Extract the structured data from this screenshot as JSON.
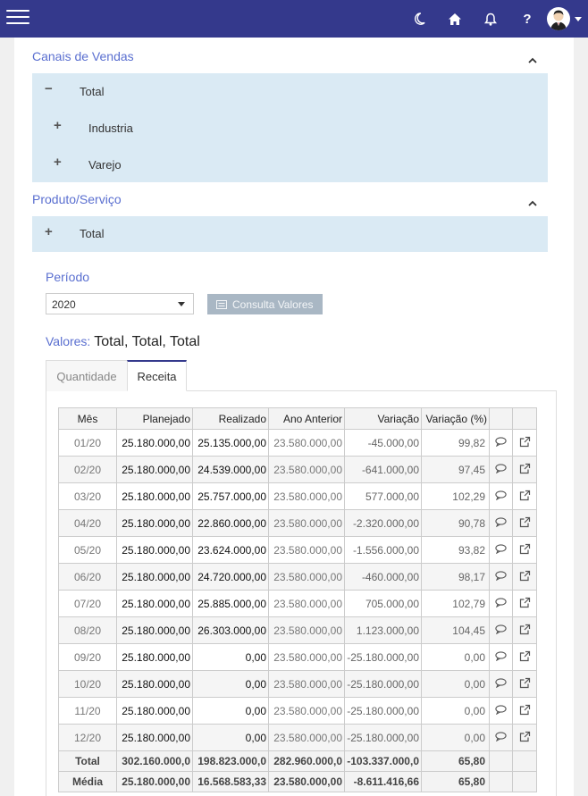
{
  "sections": {
    "canais": {
      "title": "Canais de Vendas",
      "rows": [
        {
          "toggle": "−",
          "label": "Total"
        },
        {
          "toggle": "+",
          "label": "Industria"
        },
        {
          "toggle": "+",
          "label": "Varejo"
        }
      ]
    },
    "produto": {
      "title": "Produto/Serviço",
      "rows": [
        {
          "toggle": "+",
          "label": "Total"
        }
      ]
    }
  },
  "filters": {
    "periodo_label": "Período",
    "periodo_value": "2020",
    "consulta_label": "Consulta Valores"
  },
  "valores": {
    "label": "Valores:",
    "values": "Total, Total, Total"
  },
  "tabs": [
    {
      "label": "Quantidade",
      "active": false
    },
    {
      "label": "Receita",
      "active": true
    }
  ],
  "table": {
    "headers": [
      "Mês",
      "Planejado",
      "Realizado",
      "Ano Anterior",
      "Variação",
      "Variação (%)"
    ],
    "rows": [
      [
        "01/20",
        "25.180.000,00",
        "25.135.000,00",
        "23.580.000,00",
        "-45.000,00",
        "99,82"
      ],
      [
        "02/20",
        "25.180.000,00",
        "24.539.000,00",
        "23.580.000,00",
        "-641.000,00",
        "97,45"
      ],
      [
        "03/20",
        "25.180.000,00",
        "25.757.000,00",
        "23.580.000,00",
        "577.000,00",
        "102,29"
      ],
      [
        "04/20",
        "25.180.000,00",
        "22.860.000,00",
        "23.580.000,00",
        "-2.320.000,00",
        "90,78"
      ],
      [
        "05/20",
        "25.180.000,00",
        "23.624.000,00",
        "23.580.000,00",
        "-1.556.000,00",
        "93,82"
      ],
      [
        "06/20",
        "25.180.000,00",
        "24.720.000,00",
        "23.580.000,00",
        "-460.000,00",
        "98,17"
      ],
      [
        "07/20",
        "25.180.000,00",
        "25.885.000,00",
        "23.580.000,00",
        "705.000,00",
        "102,79"
      ],
      [
        "08/20",
        "25.180.000,00",
        "26.303.000,00",
        "23.580.000,00",
        "1.123.000,00",
        "104,45"
      ],
      [
        "09/20",
        "25.180.000,00",
        "0,00",
        "23.580.000,00",
        "-25.180.000,00",
        "0,00"
      ],
      [
        "10/20",
        "25.180.000,00",
        "0,00",
        "23.580.000,00",
        "-25.180.000,00",
        "0,00"
      ],
      [
        "11/20",
        "25.180.000,00",
        "0,00",
        "23.580.000,00",
        "-25.180.000,00",
        "0,00"
      ],
      [
        "12/20",
        "25.180.000,00",
        "0,00",
        "23.580.000,00",
        "-25.180.000,00",
        "0,00"
      ]
    ],
    "footer": [
      [
        "Total",
        "302.160.000,0",
        "198.823.000,0",
        "282.960.000,0",
        "-103.337.000,0",
        "65,80"
      ],
      [
        "Média",
        "25.180.000,00",
        "16.568.583,33",
        "23.580.000,00",
        "-8.611.416,66",
        "65,80"
      ]
    ]
  },
  "icons": {
    "menu": "hamburger-icon",
    "theme": "moon-icon",
    "home": "home-icon",
    "notifications": "bell-icon",
    "help": "question-icon",
    "comment": "comment-icon",
    "open": "external-link-icon"
  },
  "colors": {
    "header": "#34398c",
    "accent": "#5a6fd0",
    "tree_bg": "#daeaf4",
    "button_bg": "#a9b7c4"
  }
}
